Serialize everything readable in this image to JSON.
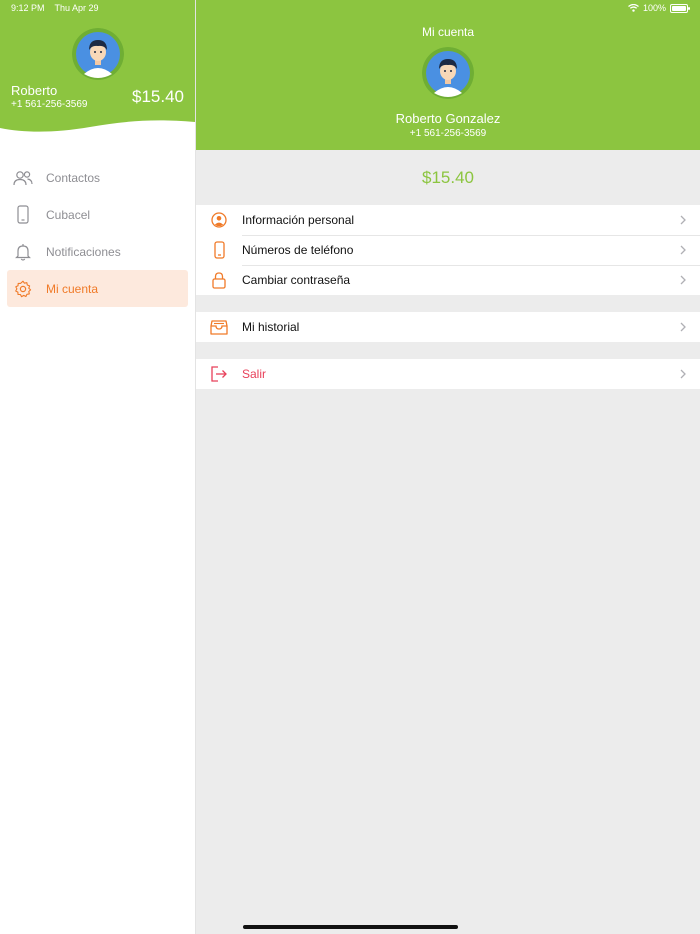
{
  "status_bar": {
    "time": "9:12 PM",
    "date": "Thu Apr 29",
    "battery": "100%"
  },
  "colors": {
    "brand_green": "#8cc540",
    "accent_orange": "#f07a28",
    "danger_pink": "#e8405a"
  },
  "sidebar": {
    "user_name": "Roberto",
    "user_phone": "+1 561-256-3569",
    "balance": "$15.40",
    "items": [
      {
        "label": "Contactos",
        "icon": "people-icon",
        "active": false
      },
      {
        "label": "Cubacel",
        "icon": "phone-device-icon",
        "active": false
      },
      {
        "label": "Notificaciones",
        "icon": "bell-icon",
        "active": false
      },
      {
        "label": "Mi cuenta",
        "icon": "gear-icon",
        "active": true
      }
    ]
  },
  "main": {
    "title": "Mi cuenta",
    "user_full_name": "Roberto Gonzalez",
    "user_phone": "+1 561-256-3569",
    "balance": "$15.40",
    "groups": [
      [
        {
          "label": "Información personal",
          "icon": "person-circle-icon"
        },
        {
          "label": "Números de teléfono",
          "icon": "phone-device-icon"
        },
        {
          "label": "Cambiar contraseña",
          "icon": "lock-icon"
        }
      ],
      [
        {
          "label": "Mi historial",
          "icon": "inbox-tray-icon"
        }
      ],
      [
        {
          "label": "Salir",
          "icon": "logout-icon"
        }
      ]
    ]
  }
}
